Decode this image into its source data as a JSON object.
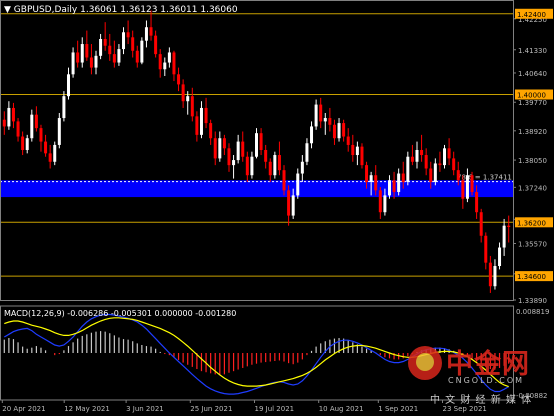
{
  "header": {
    "symbol": "GBPUSD,Daily",
    "ohlc": "1.36061 1.36123 1.36011 1.36060"
  },
  "macd_header": "MACD(12,26,9) -0.006286 -0.005301 0.000000 -0.001280",
  "watermark": {
    "brand": "中金网",
    "site": "CNGOLD.COM",
    "tagline": "中 文 财 经 新 媒 体"
  },
  "colors": {
    "background": "#000000",
    "bull": "#ffffff",
    "bear": "#ff0000",
    "level_line": "#c8a000",
    "level_label_bg": "#ffa500",
    "zone": "#0000ff",
    "fib_line": "#ffffff",
    "macd_signal": "#ffff00",
    "macd_line": "#1e3cff",
    "hist_up": "#c8c8c8",
    "hist_down": "#ff2020",
    "grid_axis": "#808080"
  },
  "chart_data": {
    "type": "candlestick",
    "title": "GBPUSD,Daily",
    "y_ticks": [
      "1.42250",
      "1.41330",
      "1.40640",
      "1.39770",
      "1.38920",
      "1.38050",
      "1.37240",
      "1.36290",
      "1.35570",
      "1.34670",
      "1.33890"
    ],
    "x_ticks": [
      "20 Apr 2021",
      "12 May 2021",
      "3 Jun 2021",
      "25 Jun 2021",
      "19 Jul 2021",
      "10 Aug 2021",
      "1 Sep 2021",
      "23 Sep 2021"
    ],
    "price_range": [
      1.3389,
      1.4275
    ],
    "levels": [
      {
        "price": 1.424,
        "label": "1.42400"
      },
      {
        "price": 1.4,
        "label": "1.40000"
      },
      {
        "price": 1.362,
        "label": "1.36200"
      },
      {
        "price": 1.346,
        "label": "1.34600"
      }
    ],
    "zone": {
      "from": 1.3695,
      "to": 1.3745
    },
    "fib": {
      "price": 1.37411,
      "label": "78.6 = 1.37411"
    },
    "candles": [
      [
        1.3925,
        1.395,
        1.388,
        1.3905
      ],
      [
        1.3905,
        1.398,
        1.3895,
        1.396
      ],
      [
        1.396,
        1.3975,
        1.39,
        1.392
      ],
      [
        1.392,
        1.393,
        1.386,
        1.3875
      ],
      [
        1.3875,
        1.389,
        1.382,
        1.3835
      ],
      [
        1.3835,
        1.388,
        1.3825,
        1.387
      ],
      [
        1.387,
        1.3955,
        1.386,
        1.394
      ],
      [
        1.394,
        1.3965,
        1.389,
        1.39
      ],
      [
        1.39,
        1.391,
        1.383,
        1.386
      ],
      [
        1.386,
        1.388,
        1.3815,
        1.3825
      ],
      [
        1.3825,
        1.385,
        1.378,
        1.38
      ],
      [
        1.38,
        1.386,
        1.379,
        1.385
      ],
      [
        1.385,
        1.3945,
        1.384,
        1.393
      ],
      [
        1.393,
        1.401,
        1.392,
        1.3995
      ],
      [
        1.3995,
        1.408,
        1.3985,
        1.406
      ],
      [
        1.406,
        1.414,
        1.405,
        1.4125
      ],
      [
        1.4125,
        1.416,
        1.408,
        1.4095
      ],
      [
        1.4095,
        1.417,
        1.408,
        1.415
      ],
      [
        1.415,
        1.419,
        1.41,
        1.411
      ],
      [
        1.411,
        1.415,
        1.406,
        1.408
      ],
      [
        1.408,
        1.413,
        1.406,
        1.4115
      ],
      [
        1.4115,
        1.418,
        1.4105,
        1.4165
      ],
      [
        1.4165,
        1.4215,
        1.413,
        1.4145
      ],
      [
        1.4145,
        1.418,
        1.41,
        1.412
      ],
      [
        1.412,
        1.416,
        1.408,
        1.4095
      ],
      [
        1.4095,
        1.415,
        1.4085,
        1.4135
      ],
      [
        1.4135,
        1.42,
        1.412,
        1.4185
      ],
      [
        1.4185,
        1.422,
        1.415,
        1.417
      ],
      [
        1.417,
        1.419,
        1.411,
        1.413
      ],
      [
        1.413,
        1.4145,
        1.408,
        1.4095
      ],
      [
        1.4095,
        1.417,
        1.409,
        1.416
      ],
      [
        1.416,
        1.422,
        1.414,
        1.42
      ],
      [
        1.42,
        1.425,
        1.416,
        1.4175
      ],
      [
        1.4175,
        1.419,
        1.411,
        1.412
      ],
      [
        1.412,
        1.4135,
        1.405,
        1.4075
      ],
      [
        1.4075,
        1.411,
        1.4055,
        1.4095
      ],
      [
        1.4095,
        1.414,
        1.408,
        1.4125
      ],
      [
        1.4125,
        1.413,
        1.404,
        1.406
      ],
      [
        1.406,
        1.408,
        1.401,
        1.403
      ],
      [
        1.403,
        1.4045,
        1.396,
        1.398
      ],
      [
        1.398,
        1.401,
        1.394,
        1.3995
      ],
      [
        1.3995,
        1.402,
        1.392,
        1.3935
      ],
      [
        1.3935,
        1.395,
        1.386,
        1.388
      ],
      [
        1.388,
        1.398,
        1.387,
        1.396
      ],
      [
        1.396,
        1.399,
        1.39,
        1.3915
      ],
      [
        1.3915,
        1.3925,
        1.385,
        1.387
      ],
      [
        1.387,
        1.389,
        1.379,
        1.381
      ],
      [
        1.381,
        1.389,
        1.38,
        1.387
      ],
      [
        1.387,
        1.388,
        1.382,
        1.384
      ],
      [
        1.384,
        1.3855,
        1.377,
        1.379
      ],
      [
        1.379,
        1.382,
        1.375,
        1.3805
      ],
      [
        1.3805,
        1.388,
        1.3795,
        1.386
      ],
      [
        1.386,
        1.389,
        1.38,
        1.3815
      ],
      [
        1.3815,
        1.383,
        1.374,
        1.376
      ],
      [
        1.376,
        1.383,
        1.375,
        1.3815
      ],
      [
        1.3815,
        1.39,
        1.381,
        1.3885
      ],
      [
        1.3885,
        1.39,
        1.382,
        1.3835
      ],
      [
        1.3835,
        1.385,
        1.378,
        1.38
      ],
      [
        1.38,
        1.381,
        1.374,
        1.376
      ],
      [
        1.376,
        1.383,
        1.375,
        1.382
      ],
      [
        1.382,
        1.386,
        1.376,
        1.3775
      ],
      [
        1.3775,
        1.379,
        1.37,
        1.3715
      ],
      [
        1.3715,
        1.373,
        1.361,
        1.364
      ],
      [
        1.364,
        1.372,
        1.363,
        1.37
      ],
      [
        1.37,
        1.378,
        1.369,
        1.3765
      ],
      [
        1.3765,
        1.382,
        1.374,
        1.38
      ],
      [
        1.38,
        1.387,
        1.379,
        1.3855
      ],
      [
        1.3855,
        1.392,
        1.384,
        1.3905
      ],
      [
        1.3905,
        1.3985,
        1.3895,
        1.397
      ],
      [
        1.397,
        1.399,
        1.39,
        1.392
      ],
      [
        1.392,
        1.3945,
        1.388,
        1.393
      ],
      [
        1.393,
        1.396,
        1.389,
        1.391
      ],
      [
        1.391,
        1.3925,
        1.385,
        1.387
      ],
      [
        1.387,
        1.393,
        1.386,
        1.3915
      ],
      [
        1.3915,
        1.3925,
        1.386,
        1.3875
      ],
      [
        1.3875,
        1.39,
        1.383,
        1.385
      ],
      [
        1.385,
        1.388,
        1.38,
        1.382
      ],
      [
        1.382,
        1.386,
        1.379,
        1.3845
      ],
      [
        1.3845,
        1.3855,
        1.378,
        1.379
      ],
      [
        1.379,
        1.38,
        1.372,
        1.374
      ],
      [
        1.374,
        1.377,
        1.37,
        1.376
      ],
      [
        1.376,
        1.379,
        1.37,
        1.3715
      ],
      [
        1.3715,
        1.3725,
        1.363,
        1.365
      ],
      [
        1.365,
        1.372,
        1.364,
        1.37
      ],
      [
        1.37,
        1.376,
        1.369,
        1.3745
      ],
      [
        1.3745,
        1.377,
        1.369,
        1.371
      ],
      [
        1.371,
        1.378,
        1.37,
        1.3765
      ],
      [
        1.3765,
        1.38,
        1.372,
        1.374
      ],
      [
        1.374,
        1.383,
        1.373,
        1.3815
      ],
      [
        1.3815,
        1.385,
        1.379,
        1.38
      ],
      [
        1.38,
        1.386,
        1.378,
        1.3835
      ],
      [
        1.3835,
        1.388,
        1.38,
        1.382
      ],
      [
        1.382,
        1.384,
        1.376,
        1.378
      ],
      [
        1.378,
        1.38,
        1.372,
        1.374
      ],
      [
        1.374,
        1.381,
        1.373,
        1.3795
      ],
      [
        1.3795,
        1.383,
        1.377,
        1.379
      ],
      [
        1.379,
        1.385,
        1.378,
        1.384
      ],
      [
        1.384,
        1.387,
        1.379,
        1.381
      ],
      [
        1.381,
        1.383,
        1.376,
        1.3775
      ],
      [
        1.3775,
        1.38,
        1.373,
        1.3745
      ],
      [
        1.3745,
        1.376,
        1.366,
        1.369
      ],
      [
        1.369,
        1.378,
        1.368,
        1.376
      ],
      [
        1.376,
        1.377,
        1.37,
        1.371
      ],
      [
        1.371,
        1.373,
        1.363,
        1.365
      ],
      [
        1.365,
        1.366,
        1.356,
        1.358
      ],
      [
        1.358,
        1.359,
        1.348,
        1.35
      ],
      [
        1.35,
        1.352,
        1.341,
        1.343
      ],
      [
        1.343,
        1.351,
        1.342,
        1.349
      ],
      [
        1.349,
        1.356,
        1.348,
        1.3545
      ],
      [
        1.3545,
        1.363,
        1.352,
        1.361
      ],
      [
        1.361,
        1.364,
        1.356,
        1.3606
      ]
    ],
    "macd": {
      "ylim": [
        -0.0088,
        0.0088
      ],
      "y_ticks": [
        "0.008819",
        "-0.00882"
      ],
      "histogram": [
        0.0025,
        0.0028,
        0.0026,
        0.002,
        0.0012,
        0.0008,
        0.001,
        0.0013,
        0.001,
        0.0005,
        0.0,
        -0.0004,
        -0.0002,
        0.0005,
        0.0013,
        0.002,
        0.0027,
        0.0032,
        0.0035,
        0.0038,
        0.004,
        0.0041,
        0.004,
        0.0037,
        0.0033,
        0.0029,
        0.0026,
        0.0025,
        0.0022,
        0.0018,
        0.0015,
        0.0013,
        0.0012,
        0.0008,
        0.0002,
        -0.0002,
        -0.0004,
        -0.0008,
        -0.0013,
        -0.0018,
        -0.0022,
        -0.0026,
        -0.003,
        -0.0034,
        -0.0036,
        -0.0038,
        -0.004,
        -0.0041,
        -0.004,
        -0.0037,
        -0.0034,
        -0.0031,
        -0.0028,
        -0.0025,
        -0.0022,
        -0.002,
        -0.0018,
        -0.0017,
        -0.0016,
        -0.0015,
        -0.0014,
        -0.0016,
        -0.0019,
        -0.0021,
        -0.0018,
        -0.0012,
        -0.0004,
        0.0004,
        0.0012,
        0.0018,
        0.0022,
        0.0025,
        0.0027,
        0.0028,
        0.0027,
        0.0024,
        0.002,
        0.0016,
        0.0012,
        0.0008,
        0.0005,
        0.0001,
        -0.0004,
        -0.0008,
        -0.001,
        -0.0012,
        -0.0012,
        -0.001,
        -0.0006,
        -0.0002,
        0.0002,
        0.0005,
        0.0007,
        0.0009,
        0.001,
        0.001,
        0.0009,
        0.0007,
        0.0004,
        0.0001,
        -0.0003,
        -0.0007,
        -0.0011,
        -0.0016,
        -0.0021,
        -0.0026,
        -0.003,
        -0.0031,
        -0.0028,
        -0.0024,
        -0.002
      ],
      "signal": [
        0.0055,
        0.0058,
        0.006,
        0.006,
        0.0058,
        0.0055,
        0.0052,
        0.005,
        0.0048,
        0.0045,
        0.0042,
        0.0038,
        0.0035,
        0.0033,
        0.0033,
        0.0035,
        0.0038,
        0.0042,
        0.0047,
        0.0052,
        0.0056,
        0.006,
        0.0063,
        0.0065,
        0.0066,
        0.0066,
        0.0065,
        0.0064,
        0.0063,
        0.0061,
        0.0058,
        0.0055,
        0.0052,
        0.0049,
        0.0046,
        0.0042,
        0.0038,
        0.0033,
        0.0027,
        0.002,
        0.0013,
        0.0005,
        -0.0003,
        -0.0011,
        -0.0019,
        -0.0027,
        -0.0034,
        -0.0041,
        -0.0047,
        -0.0052,
        -0.0056,
        -0.0059,
        -0.0061,
        -0.0062,
        -0.0062,
        -0.0062,
        -0.0061,
        -0.006,
        -0.0058,
        -0.0056,
        -0.0054,
        -0.0052,
        -0.005,
        -0.0048,
        -0.0045,
        -0.0042,
        -0.0038,
        -0.0033,
        -0.0027,
        -0.002,
        -0.0013,
        -0.0007,
        -0.0001,
        0.0004,
        0.0008,
        0.0011,
        0.0013,
        0.0014,
        0.0014,
        0.0013,
        0.0011,
        0.0009,
        0.0006,
        0.0003,
        0.0,
        -0.0003,
        -0.0005,
        -0.0007,
        -0.0008,
        -0.0008,
        -0.0007,
        -0.0005,
        -0.0003,
        -0.0001,
        0.0001,
        0.0002,
        0.0003,
        0.0003,
        0.0002,
        0.0,
        -0.0003,
        -0.0007,
        -0.0012,
        -0.0018,
        -0.0025,
        -0.0032,
        -0.004,
        -0.0048,
        -0.0055,
        -0.006,
        -0.0063
      ],
      "macd_line": [
        0.003,
        0.0035,
        0.004,
        0.0043,
        0.0045,
        0.0046,
        0.0042,
        0.0035,
        0.003,
        0.0025,
        0.002,
        0.0015,
        0.0013,
        0.0015,
        0.0022,
        0.003,
        0.004,
        0.005,
        0.0058,
        0.0064,
        0.0068,
        0.0071,
        0.0072,
        0.0072,
        0.0071,
        0.0069,
        0.0067,
        0.0065,
        0.0062,
        0.0058,
        0.0052,
        0.0045,
        0.0036,
        0.0027,
        0.0018,
        0.0009,
        0.0,
        -0.0008,
        -0.0016,
        -0.0024,
        -0.0032,
        -0.004,
        -0.0048,
        -0.0055,
        -0.0062,
        -0.0067,
        -0.0071,
        -0.0074,
        -0.0076,
        -0.0077,
        -0.0077,
        -0.0076,
        -0.0074,
        -0.0072,
        -0.0069,
        -0.0066,
        -0.0063,
        -0.006,
        -0.0057,
        -0.0055,
        -0.0054,
        -0.0055,
        -0.0058,
        -0.006,
        -0.0058,
        -0.0052,
        -0.0043,
        -0.0032,
        -0.002,
        -0.0008,
        0.0003,
        0.0012,
        0.0018,
        0.0022,
        0.0024,
        0.0024,
        0.0022,
        0.0019,
        0.0015,
        0.001,
        0.0005,
        0.0,
        -0.0006,
        -0.0012,
        -0.0016,
        -0.0018,
        -0.0018,
        -0.0016,
        -0.0012,
        -0.0007,
        -0.0002,
        0.0003,
        0.0006,
        0.0008,
        0.0009,
        0.0009,
        0.0008,
        0.0005,
        0.0001,
        -0.0004,
        -0.001,
        -0.0018,
        -0.0028,
        -0.0039,
        -0.005,
        -0.006,
        -0.0068,
        -0.0072,
        -0.0072,
        -0.0068,
        -0.0063
      ]
    }
  }
}
